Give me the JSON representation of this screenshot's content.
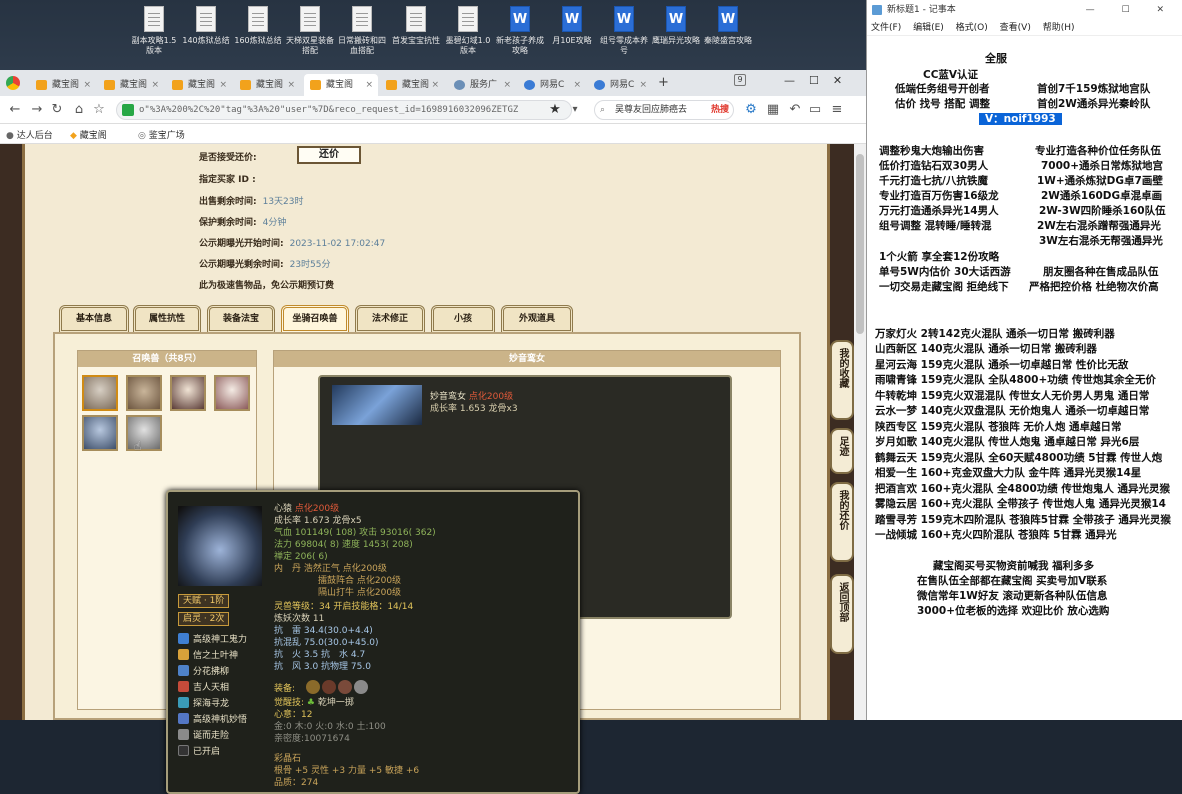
{
  "desktop": {
    "icons": [
      {
        "label": "副本攻略1.5版本",
        "type": "doc"
      },
      {
        "label": "140炼狱总结",
        "type": "doc"
      },
      {
        "label": "160炼狱总结",
        "type": "doc"
      },
      {
        "label": "天梯双星装备搭配",
        "type": "doc"
      },
      {
        "label": "日常搬砖和四血搭配",
        "type": "doc"
      },
      {
        "label": "首发宝宝抗性",
        "type": "doc"
      },
      {
        "label": "墨碧幻域1.0版本",
        "type": "doc"
      },
      {
        "label": "新老孩子养成攻略",
        "type": "word"
      },
      {
        "label": "月10E攻略",
        "type": "word"
      },
      {
        "label": "组号零成本养号",
        "type": "word"
      },
      {
        "label": "鹰瑞异光攻略",
        "type": "word"
      },
      {
        "label": "秦陵盛宫攻略",
        "type": "word"
      }
    ]
  },
  "browser": {
    "tabs": [
      {
        "label": "藏宝阁",
        "active": false
      },
      {
        "label": "藏宝阁",
        "active": false
      },
      {
        "label": "藏宝阁",
        "active": false
      },
      {
        "label": "藏宝阁",
        "active": false
      },
      {
        "label": "藏宝阁",
        "active": true
      },
      {
        "label": "藏宝阁",
        "active": false
      },
      {
        "label": "服务广",
        "active": false
      },
      {
        "label": "网易C",
        "active": false
      },
      {
        "label": "网易C",
        "active": false
      }
    ],
    "tab_counter": "9",
    "new_tab": "+",
    "url": "o\"%3A%200%2C%20\"tag\"%3A%20\"user\"%7D&reco_request_id=1698916032096ZETGZ",
    "search_text": "吴尊友回应肺癌去",
    "search_hot": "热搜",
    "bookmarks": [
      "达人后台",
      "藏宝阁",
      "鉴宝广场"
    ]
  },
  "listing": {
    "accept_offer_label": "是否接受还价:",
    "offer_button": "还价",
    "buyer_label": "指定买家 ID :",
    "remaining_label": "出售剩余时间:",
    "remaining_value": "13天23时",
    "protect_label": "保护剩余时间:",
    "protect_value": "4分钟",
    "publicity_start_label": "公示期曝光开始时间:",
    "publicity_start_value": "2023-11-02 17:02:47",
    "publicity_left_label": "公示期曝光剩余时间:",
    "publicity_left_value": "23时55分",
    "note": "此为极速售物品，免公示期预订费"
  },
  "game_tabs": [
    {
      "label": "基本信息",
      "active": false
    },
    {
      "label": "属性抗性",
      "active": false
    },
    {
      "label": "装备法宝",
      "active": false
    },
    {
      "label": "坐骑召唤兽",
      "active": true
    },
    {
      "label": "法术修正",
      "active": false
    },
    {
      "label": "小孩",
      "active": false
    },
    {
      "label": "外观道具",
      "active": false
    }
  ],
  "pets": {
    "title": "召唤兽（共8只）",
    "count": 6
  },
  "detail": {
    "title": "妙音鸾女",
    "card_name": "妙音鸾女",
    "card_level": "点化200级",
    "card_growth": "成长率 1.653 龙骨x3"
  },
  "popup": {
    "name": "心猿",
    "level": "点化200级",
    "growth": "成长率 1.673 龙骨x5",
    "hp": "气血 101149( 108) 攻击 93016( 362)",
    "mp": "法力 69804( 8) 速度 1453( 208)",
    "ding": "禅定 206( 6)",
    "neidan1": "内　丹  浩然正气 点化200级",
    "neidan2": "擂鼓阵合 点化200级",
    "neidan3": "隔山打牛 点化200级",
    "lingshou": "灵兽等级：34 开启技能格：14/14",
    "lianyao": "炼妖次数 11",
    "kangxing1": "抗　雷 34.4(30.0+4.4)",
    "kangxing2": "抗混乱 75.0(30.0+45.0)",
    "kangxing3": "抗　火 3.5 抗　水 4.7",
    "kangxing4": "抗　风 3.0 抗物理 75.0",
    "equip_label": "装备:",
    "juexing": "觉醒技:",
    "juexing_val": "乾坤一掷",
    "xindu": "心意：12",
    "wuxing": "金:0 木:0 火:0 水:0 土:100",
    "qinmi": "亲密度:10071674",
    "caishi": "彩晶石",
    "genggu": "根骨 +5 灵性 +3 力量 +5 敏捷 +6",
    "pinzhi": "品质：274",
    "badge1": "天赋 · 1阶",
    "badge2": "启灵 · 2次",
    "skills": [
      {
        "label": "高级神工鬼力",
        "color": "#3f7fd1"
      },
      {
        "label": "信之土叶神",
        "color": "#d8a13a"
      },
      {
        "label": "分花拂柳",
        "color": "#4e82c9"
      },
      {
        "label": "吉人天相",
        "color": "#c54b3a"
      },
      {
        "label": "探海寻龙",
        "color": "#3a9bb8"
      },
      {
        "label": "高级神机妙悟",
        "color": "#5477c4"
      },
      {
        "label": "诞而走险",
        "color": "#8a8a8a"
      },
      {
        "label": "已开启",
        "color": "#333333"
      }
    ]
  },
  "side_float": [
    {
      "label": "我的收藏"
    },
    {
      "label": "足迹"
    },
    {
      "label": "我的还价"
    },
    {
      "label": "返回顶部"
    }
  ],
  "notepad": {
    "title": "新标题1 - 记事本",
    "controls": "— ☐ ✕",
    "menu": [
      "文件(F)",
      "编辑(E)",
      "格式(O)",
      "查看(V)",
      "帮助(H)"
    ],
    "lines": {
      "h1": "全服",
      "h2": "CC蓝V认证",
      "h3": "低端任务组号开创者",
      "h3b": "首创7千159炼狱地宫队",
      "h4": "估价 找号 搭配 调整",
      "h4b": "首创2W通杀异光秦岭队",
      "vx": "V：noif1993",
      "a1": "调整秒鬼大炮输出伤害",
      "a1b": "专业打造各种价位任务队伍",
      "a2": "低价打造钻石双30男人",
      "a2b": "7000+通杀日常炼狱地宫",
      "a3": "千元打造七抗/八抗铁魔",
      "a3b": "1W+通杀炼狱DG卓7画壁",
      "a4": "专业打造百万伤害16级龙",
      "a4b": "2W通杀160DG卓混卓画",
      "a5": "万元打造通杀异光14男人",
      "a5b": "2W-3W四阶睡杀160队伍",
      "a6": "组号调整 混转睡/睡转混",
      "a6b": "2W左右混杀蹭帮强通异光",
      "a7b": "3W左右混杀无帮强通异光",
      "b1": "1个火箭 享全套12份攻略",
      "b2": "单号5W内估价 30大话西游",
      "b2b": "朋友圈各种在售成品队伍",
      "b3": "一切交易走藏宝阁 拒绝线下",
      "b3b": "严格把控价格 杜绝物次价高",
      "c1": "万家灯火 2转142克火混队 通杀一切日常 搬砖利器",
      "c2": "山西新区 140克火混队 通杀一切日常 搬砖利器",
      "c3": "星河云海 159克火混队 通杀一切卓越日常 性价比无敌",
      "c4": "雨啸青锋 159克火混队 全队4800+功绩 传世炮其余全无价",
      "c5": "牛转乾坤 159克火双混混队 传世女人无价男人男鬼 通日常",
      "c6": "云水一梦 140克火双盘混队 无价炮鬼人 通杀一切卓越日常",
      "c7": "陕西专区 159克火混队 苍狼阵 无价人炮 通卓越日常",
      "c8": "岁月如歌 140克火混队 传世人炮鬼 通卓越日常 异光6层",
      "c9": "鹤舞云天 159克火混队 全60天赋4800功绩 5甘霖 传世人炮",
      "c10": "相爱一生 160+克金双盘大力队 金牛阵 通异光灵猴14星",
      "c11": "把酒言欢 160+克火混队 全4800功绩 传世炮鬼人 通异光灵猴",
      "c12": "雾隐云居 160+克火混队 全带孩子 传世炮人鬼 通异光灵猴14",
      "c13": "踏雪寻芳 159克木四阶混队 苍狼阵5甘霖 全带孩子 通异光灵猴",
      "c14": "一战倾城 160+克火四阶混队 苍狼阵 5甘霖 通异光",
      "d1": "藏宝阁买号买物资前喊我 福利多多",
      "d2": "在售队伍全部都在藏宝阁 买卖号加V联系",
      "d3": "微信常年1W好友 滚动更新各种队伍信息",
      "d4": "3000+位老板的选择 欢迎比价 放心选购"
    }
  }
}
